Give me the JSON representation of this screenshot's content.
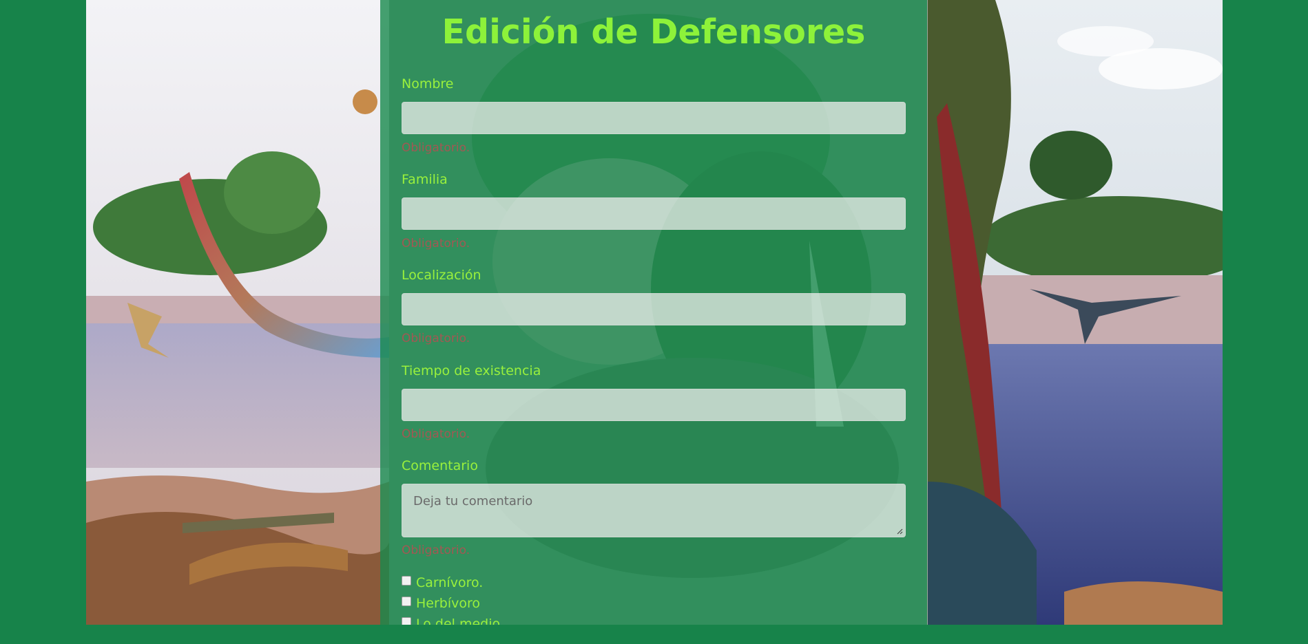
{
  "form": {
    "title": "Edición de Defensores",
    "fields": [
      {
        "label": "Nombre",
        "value": "",
        "required_text": "Obligatorio."
      },
      {
        "label": "Familia",
        "value": "",
        "required_text": "Obligatorio."
      },
      {
        "label": "Localización",
        "value": "",
        "required_text": "Obligatorio."
      },
      {
        "label": "Tiempo de existencia",
        "value": "",
        "required_text": "Obligatorio."
      }
    ],
    "comment": {
      "label": "Comentario",
      "placeholder": "Deja tu comentario",
      "required_text": "Obligatorio."
    },
    "diet_options": [
      {
        "label": "Carnívoro.",
        "checked": false
      },
      {
        "label": "Herbívoro",
        "checked": false
      },
      {
        "label": "Lo del medio",
        "checked": false
      }
    ]
  },
  "colors": {
    "page_background": "#17834a",
    "accent_text": "#9af13c",
    "title_text": "#8df23a",
    "required_text": "#c84650"
  }
}
